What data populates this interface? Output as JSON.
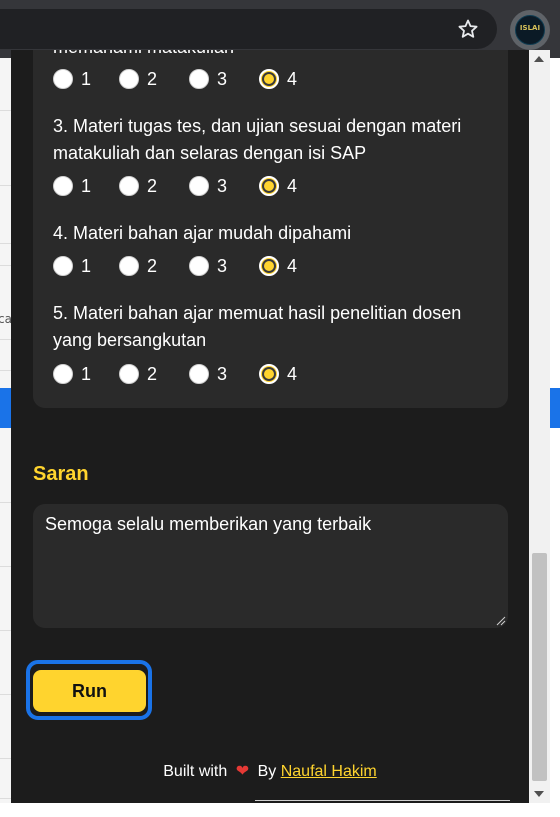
{
  "browser": {
    "extension_logo_text": "ISLAI"
  },
  "background": {
    "partial_text": "ca"
  },
  "questions": [
    {
      "text": "memahami matakuliah",
      "selected": 4
    },
    {
      "text": "3. Materi tugas tes, dan ujian sesuai dengan materi matakuliah dan selaras dengan isi SAP",
      "selected": 4
    },
    {
      "text": "4. Materi bahan ajar mudah dipahami",
      "selected": 4
    },
    {
      "text": "5. Materi bahan ajar memuat hasil penelitian dosen yang bersangkutan",
      "selected": 4
    }
  ],
  "options": [
    "1",
    "2",
    "3",
    "4"
  ],
  "saran": {
    "title": "Saran",
    "value": "Semoga selalu memberikan yang terbaik"
  },
  "run_button": {
    "label": "Run"
  },
  "footer": {
    "built_with": "Built with",
    "by": "By",
    "author": "Naufal Hakim"
  },
  "colors": {
    "accent": "#ffd42e",
    "popup_bg": "#1c1c1c",
    "card_bg": "#2a2a2a",
    "highlight": "#1a73e8",
    "heart": "#e53935"
  },
  "icons": [
    "star-icon",
    "extension-icon",
    "heart-icon",
    "resize-grip-icon",
    "scroll-up-icon",
    "scroll-down-icon"
  ]
}
